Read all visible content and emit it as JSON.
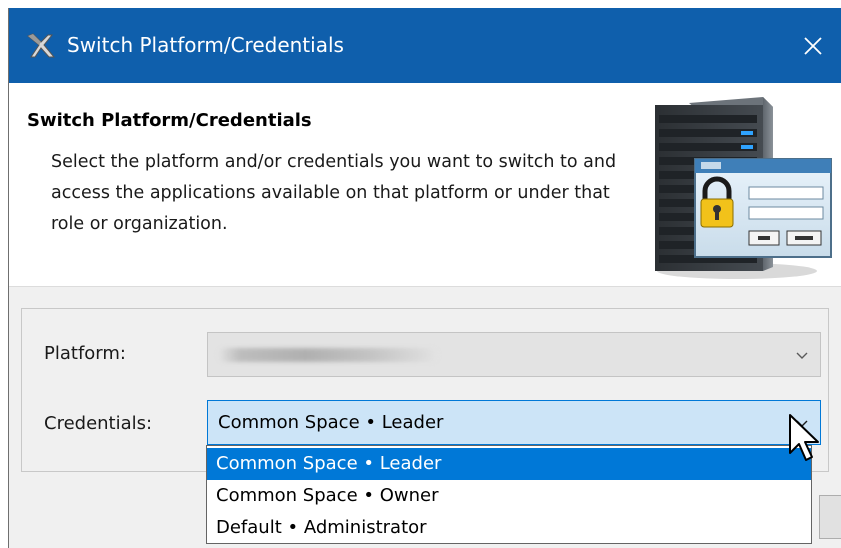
{
  "window": {
    "title": "Switch Platform/Credentials",
    "title_icon": "no-magic-logo-icon",
    "close_icon": "close-icon",
    "title_bar_color": "#0f5fac"
  },
  "banner": {
    "heading": "Switch Platform/Credentials",
    "description": "Select the platform and/or credentials you want to switch to and access the applications available on that platform or under that role or organization.",
    "illustration": "server-login-icon"
  },
  "form": {
    "platform_label": "Platform:",
    "platform_value": "",
    "credentials_label": "Credentials:",
    "credentials_value": "Common Space • Leader"
  },
  "dropdown": {
    "options": [
      "Common Space • Leader",
      "Common Space • Owner",
      "Default • Administrator"
    ],
    "selected_index": 0,
    "highlight_color": "#0078d7"
  }
}
